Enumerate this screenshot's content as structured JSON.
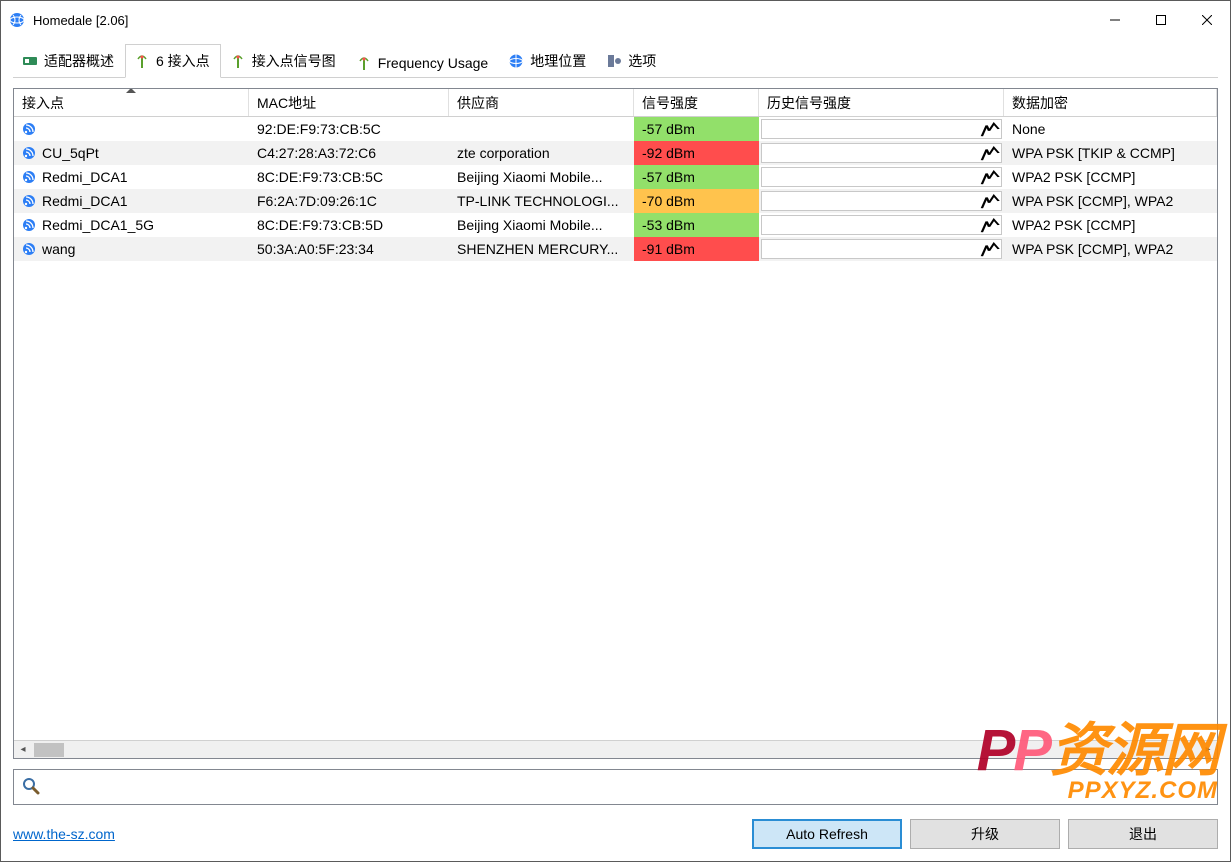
{
  "window": {
    "title": "Homedale [2.06]"
  },
  "tabs": [
    {
      "label": "适配器概述",
      "icon": "adapter-icon"
    },
    {
      "label": "6 接入点",
      "icon": "antenna-icon",
      "active": true
    },
    {
      "label": "接入点信号图",
      "icon": "antenna-icon"
    },
    {
      "label": "Frequency Usage",
      "icon": "antenna-icon"
    },
    {
      "label": "地理位置",
      "icon": "globe-icon"
    },
    {
      "label": "选项",
      "icon": "options-icon"
    }
  ],
  "columns": {
    "ap": "接入点",
    "mac": "MAC地址",
    "vendor": "供应商",
    "signal": "信号强度",
    "history": "历史信号强度",
    "encryption": "数据加密"
  },
  "signal_colors": {
    "green": "#92e06a",
    "yellow": "#ffc34d",
    "red": "#ff4d4d"
  },
  "rows": [
    {
      "ap": "",
      "mac": "92:DE:F9:73:CB:5C",
      "vendor": "",
      "signal": "-57 dBm",
      "level": "green",
      "encryption": "None"
    },
    {
      "ap": "CU_5qPt",
      "mac": "C4:27:28:A3:72:C6",
      "vendor": "zte corporation",
      "signal": "-92 dBm",
      "level": "red",
      "encryption": "WPA PSK [TKIP & CCMP]"
    },
    {
      "ap": "Redmi_DCA1",
      "mac": "8C:DE:F9:73:CB:5C",
      "vendor": "Beijing Xiaomi Mobile...",
      "signal": "-57 dBm",
      "level": "green",
      "encryption": "WPA2 PSK [CCMP]"
    },
    {
      "ap": "Redmi_DCA1",
      "mac": "F6:2A:7D:09:26:1C",
      "vendor": "TP-LINK TECHNOLOGI...",
      "signal": "-70 dBm",
      "level": "yellow",
      "encryption": "WPA PSK [CCMP], WPA2"
    },
    {
      "ap": "Redmi_DCA1_5G",
      "mac": "8C:DE:F9:73:CB:5D",
      "vendor": "Beijing Xiaomi Mobile...",
      "signal": "-53 dBm",
      "level": "green",
      "encryption": "WPA2 PSK [CCMP]"
    },
    {
      "ap": "wang",
      "mac": "50:3A:A0:5F:23:34",
      "vendor": "SHENZHEN MERCURY...",
      "signal": "-91 dBm",
      "level": "red",
      "encryption": "WPA PSK [CCMP], WPA2"
    }
  ],
  "search": {
    "placeholder": ""
  },
  "footer": {
    "link": "www.the-sz.com",
    "auto_refresh": "Auto Refresh",
    "upgrade": "升级",
    "exit": "退出"
  },
  "watermark": {
    "line1_a": "P",
    "line1_b": "P",
    "line1_c": "资源网",
    "line2": "PPXYZ.COM"
  }
}
